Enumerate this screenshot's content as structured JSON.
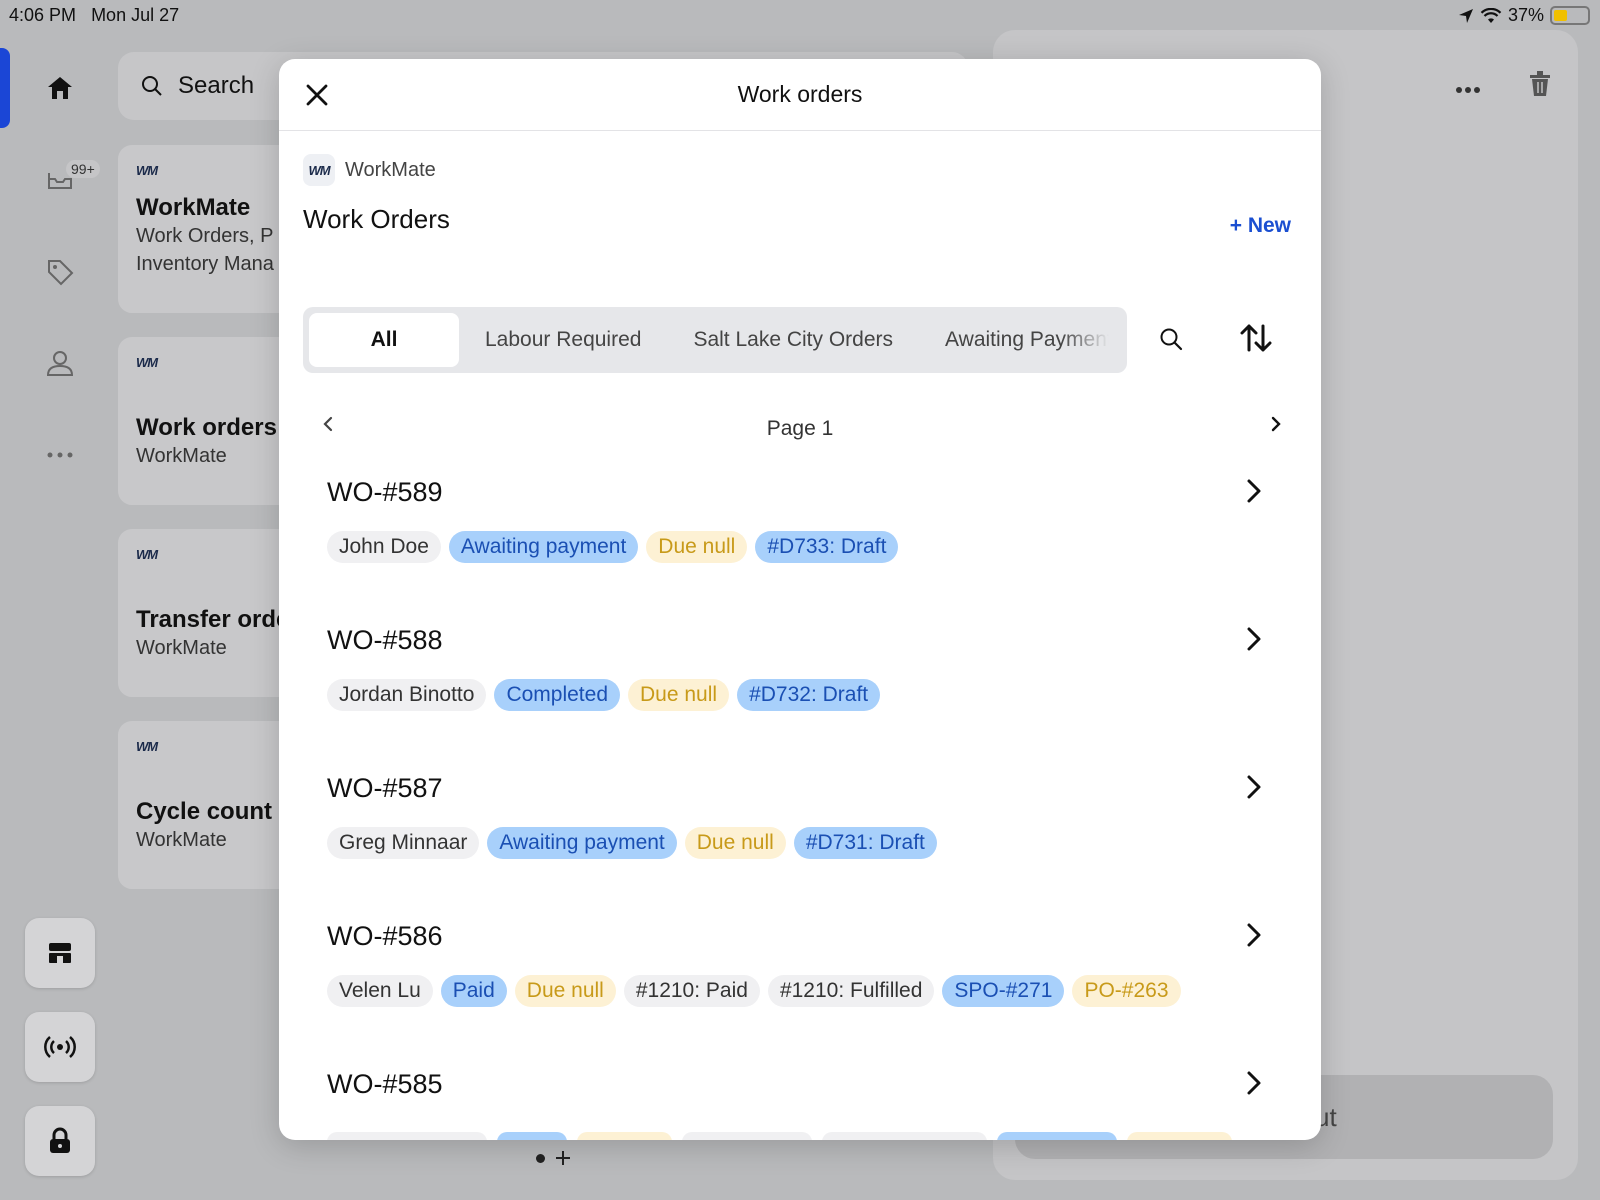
{
  "status_bar": {
    "time": "4:06 PM",
    "date": "Mon Jul 27",
    "battery": "37%",
    "battery_level": 0.37
  },
  "sidebar": {
    "badge": "99+"
  },
  "background": {
    "search_label": "Search",
    "cards": [
      {
        "title": "WorkMate",
        "lines": [
          "Work Orders, P",
          "Inventory Mana"
        ]
      },
      {
        "title": "Work orders",
        "lines": [
          "WorkMate"
        ]
      },
      {
        "title": "Transfer orde",
        "lines": [
          "WorkMate"
        ]
      },
      {
        "title": "Cycle count",
        "lines": [
          "WorkMate"
        ]
      }
    ],
    "right_button": "ut"
  },
  "modal": {
    "title": "Work orders",
    "app_name": "WorkMate",
    "logo_text": "WM",
    "heading": "Work Orders",
    "new_label": "+ New",
    "tabs": [
      "All",
      "Labour Required",
      "Salt Lake City Orders",
      "Awaiting Payment"
    ],
    "active_tab": "All",
    "page_label": "Page 1",
    "orders": [
      {
        "id": "WO-#589",
        "tags": [
          {
            "text": "John Doe",
            "style": "gray"
          },
          {
            "text": "Awaiting payment",
            "style": "blue"
          },
          {
            "text": "Due null",
            "style": "yellow"
          },
          {
            "text": "#D733: Draft",
            "style": "blue"
          }
        ]
      },
      {
        "id": "WO-#588",
        "tags": [
          {
            "text": "Jordan Binotto",
            "style": "gray"
          },
          {
            "text": "Completed",
            "style": "blue"
          },
          {
            "text": "Due null",
            "style": "yellow"
          },
          {
            "text": "#D732: Draft",
            "style": "blue"
          }
        ]
      },
      {
        "id": "WO-#587",
        "tags": [
          {
            "text": "Greg Minnaar",
            "style": "gray"
          },
          {
            "text": "Awaiting payment",
            "style": "blue"
          },
          {
            "text": "Due null",
            "style": "yellow"
          },
          {
            "text": "#D731: Draft",
            "style": "blue"
          }
        ]
      },
      {
        "id": "WO-#586",
        "tags": [
          {
            "text": "Velen Lu",
            "style": "gray"
          },
          {
            "text": "Paid",
            "style": "blue"
          },
          {
            "text": "Due null",
            "style": "yellow"
          },
          {
            "text": "#1210: Paid",
            "style": "gray"
          },
          {
            "text": "#1210: Fulfilled",
            "style": "gray"
          },
          {
            "text": "SPO-#271",
            "style": "blue"
          },
          {
            "text": "PO-#263",
            "style": "yellow"
          }
        ]
      },
      {
        "id": "WO-#585",
        "tags": []
      }
    ]
  },
  "colors": {
    "accent": "#1b4fd1",
    "tag_blue_bg": "#a8d0fb",
    "tag_yellow_bg": "#fdf1d4",
    "tag_gray_bg": "#f0f0f2"
  }
}
